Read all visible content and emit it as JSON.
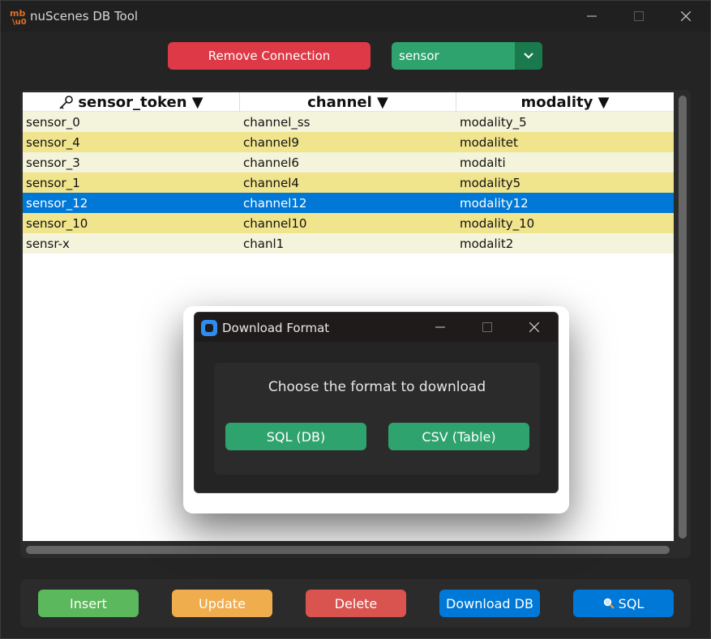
{
  "window": {
    "title": "nuScenes DB Tool",
    "logo_text": "mb"
  },
  "toolbar": {
    "remove_connection_label": "Remove Connection",
    "table_select_value": "sensor"
  },
  "table": {
    "headers": [
      {
        "label": "sensor_token ▼",
        "icon": "key-icon"
      },
      {
        "label": "channel ▼"
      },
      {
        "label": "modality ▼"
      }
    ],
    "rows": [
      {
        "cells": [
          "sensor_0",
          "channel_ss",
          "modality_5"
        ],
        "bg": "#f4f4dc"
      },
      {
        "cells": [
          "sensor_4",
          "channel9",
          "modalitet"
        ],
        "bg": "#f0e48c"
      },
      {
        "cells": [
          "sensor_3",
          "channel6",
          "modalti"
        ],
        "bg": "#f4f4dc"
      },
      {
        "cells": [
          "sensor_1",
          "channel4",
          "modality5"
        ],
        "bg": "#f0e48c"
      },
      {
        "cells": [
          "sensor_12",
          "channel12",
          "modality12"
        ],
        "bg": "#0078d7",
        "selected": true
      },
      {
        "cells": [
          "sensor_10",
          "channel10",
          "modality_10"
        ],
        "bg": "#f0e48c"
      },
      {
        "cells": [
          "sensr-x",
          "chanl1",
          "modalit2"
        ],
        "bg": "#f4f4dc"
      }
    ]
  },
  "actions": {
    "insert_label": "Insert",
    "update_label": "Update",
    "delete_label": "Delete",
    "download_label": "Download DB",
    "sql_label": "SQL"
  },
  "dialog": {
    "title": "Download Format",
    "prompt": "Choose the format to download",
    "sql_label": "SQL (DB)",
    "csv_label": "CSV (Table)"
  },
  "colors": {
    "accent_green": "#2ea36d",
    "danger_red": "#de3946",
    "selection_blue": "#0078d7"
  }
}
